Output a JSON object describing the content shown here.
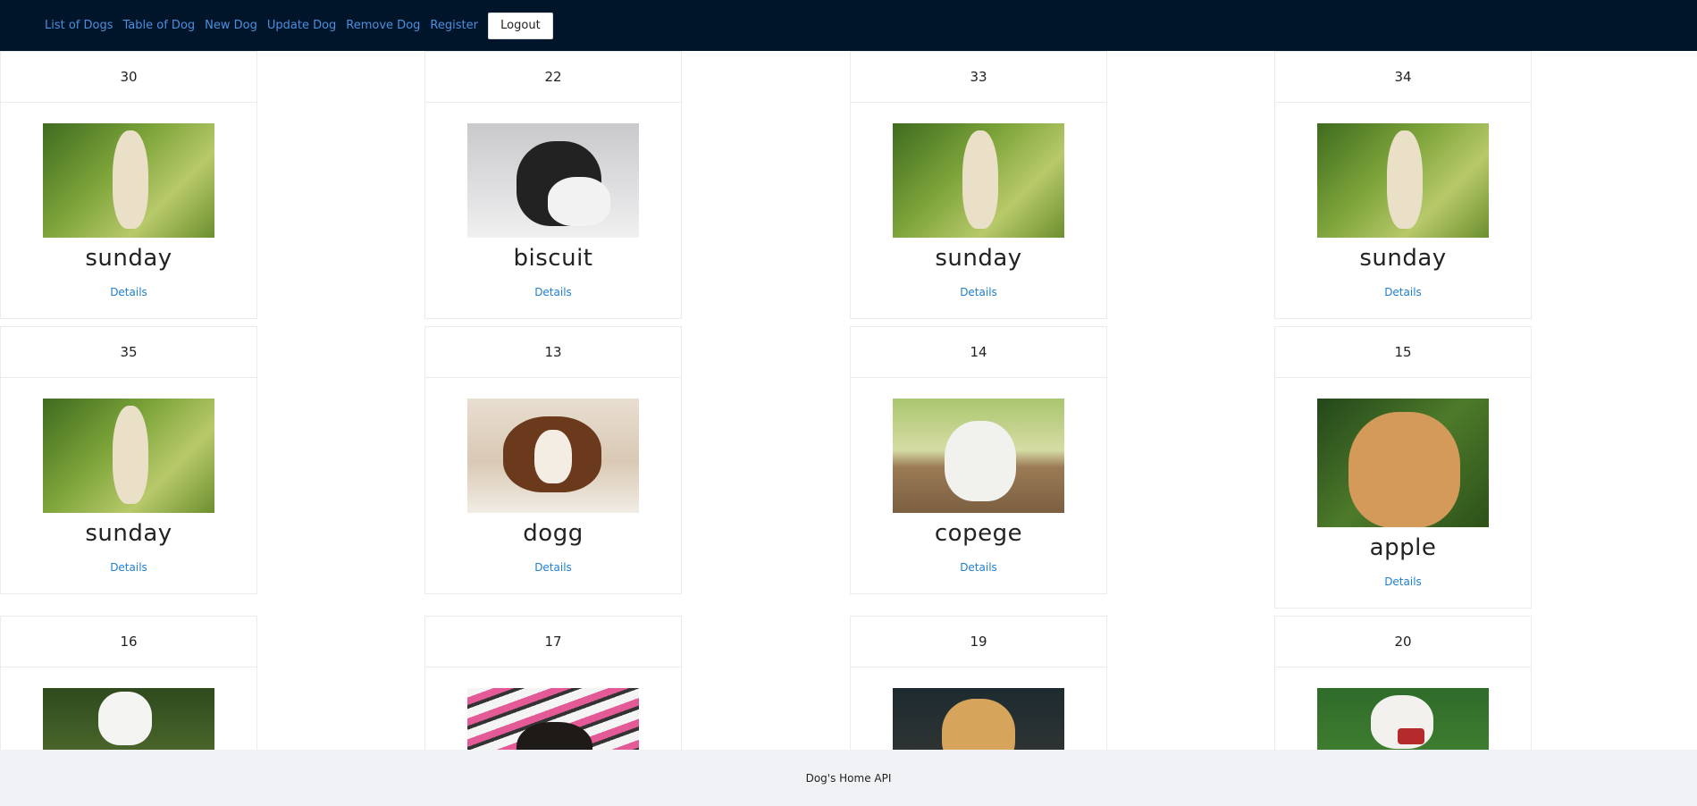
{
  "nav": {
    "links": [
      "List of Dogs",
      "Table of Dog",
      "New Dog",
      "Update Dog",
      "Remove Dog",
      "Register"
    ],
    "logout_label": "Logout"
  },
  "cards": [
    {
      "id": "30",
      "name": "sunday",
      "details": "Details",
      "image": "labrador-sitting"
    },
    {
      "id": "22",
      "name": "biscuit",
      "details": "Details",
      "image": "french-bulldog"
    },
    {
      "id": "33",
      "name": "sunday",
      "details": "Details",
      "image": "labrador-sitting"
    },
    {
      "id": "34",
      "name": "sunday",
      "details": "Details",
      "image": "labrador-sitting"
    },
    {
      "id": "35",
      "name": "sunday",
      "details": "Details",
      "image": "labrador-sitting"
    },
    {
      "id": "13",
      "name": "dogg",
      "details": "Details",
      "image": "spaniel-lying"
    },
    {
      "id": "14",
      "name": "copege",
      "details": "Details",
      "image": "white-puppy-deck"
    },
    {
      "id": "15",
      "name": "apple",
      "details": "Details",
      "image": "golden-labrador-portrait"
    },
    {
      "id": "16",
      "name": "",
      "details": "",
      "image": "white-dog-grass"
    },
    {
      "id": "17",
      "name": "",
      "details": "",
      "image": "dachshund-pink-blanket"
    },
    {
      "id": "19",
      "name": "",
      "details": "",
      "image": "golden-retriever-dark"
    },
    {
      "id": "20",
      "name": "",
      "details": "",
      "image": "white-dog-lawn"
    }
  ],
  "footer": {
    "text": "Dog's Home API"
  }
}
